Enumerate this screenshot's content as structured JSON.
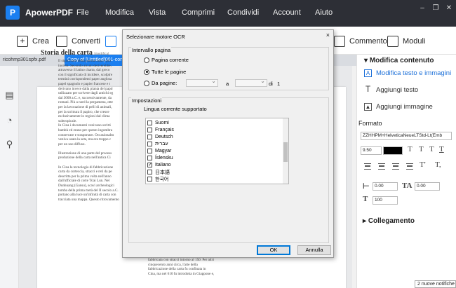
{
  "app": {
    "name": "ApowerPDF",
    "logo_letter": "P"
  },
  "menu": [
    "File",
    "Modifica",
    "Vista",
    "Comprimi",
    "Condividi",
    "Account",
    "Aiuto"
  ],
  "toolbar": {
    "crea": "Crea",
    "converti": "Converti",
    "commento": "Commento",
    "moduli": "Moduli"
  },
  "tabs": [
    {
      "label": "ricohmp301spfx.pdf",
      "active": false
    },
    {
      "label": "Copy of [Untitled]001-conve...",
      "active": true
    }
  ],
  "document": {
    "title": "Storia della carta",
    "title_note": "[modifica]",
    "col1": [
      "Il significato della parola carta è piu",
      "incerto. Secondo alcuni deriverebbe,",
      "attraverso il latino charta, dal greco",
      "con il significato di incidere, scolpire",
      "termini corrispondenti paper anglosa",
      "papel spagnolo e papier francese e t",
      "derivano invece dalla pianta del papir",
      "utilizzato per scrivere dagli antichi eg",
      "dal 3000 a.C. e, successivamente, da",
      "romani. Più a nord la pergamena, otte",
      "per la lavorazione di pelli di animali,",
      "per la scrittura il papiro, che cresce",
      "esclusivamente in regioni dal clima",
      "subtropicale.",
      "In Cina i documenti venivano scritti",
      "bambù ed erano per questo ingombra",
      "conservare e trasportare. Occasionalm",
      "veniva usata la seta, ma era troppo c",
      "per un uso diffuso.",
      "",
      "Illustrazione di una parte del process",
      "produzione della carta nell'antica Ci",
      "",
      "In Cina la tecnologia di fabbricazione",
      "carta da corteccia, stracci e reti da pe",
      "descritta per la prima volta nell'anno",
      "dall'ufficiale di corte Ts'ai Lun. Nel",
      "Dunhuang (Gansu), scavi archeologici",
      "tomba della prima metà del II secolo a.C.",
      "portano alla luce un'infinità di carta con",
      "tracciata una mappa. Questo ritrovamento"
    ],
    "col2": [
      "fabbricata con stracci intorno al 150. Per altri",
      "cinquecento anni circa, l'arte della",
      "fabbricazione della carta fu confinata in",
      "Cina, ma nel 610 fu introdotta in Giappone e,"
    ]
  },
  "right_panel": {
    "modifica_contenuto": "Modifica contenuto",
    "items": [
      "Modifica testo e immagini",
      "Aggiungi testo",
      "Aggiungi immagine"
    ],
    "formato": "Formato",
    "font": "ZZHHPM+HelveticaNeueLTStd-Lt(Emb",
    "font_size": "9.50",
    "text_color": "#000000",
    "spacing1": "0.00",
    "spacing2": "0.00",
    "scale": "100",
    "collegamento": "Collegamento"
  },
  "notification": "2 nuove notifiche",
  "dialog": {
    "title": "Selezionare motore OCR",
    "close": "×",
    "intervallo_pagina": "Intervallo pagina",
    "radio_pagina_corrente": "Pagina corrente",
    "radio_tutte": "Tutte le pagine",
    "radio_da_pagine": "Da pagine:",
    "selected_range": "tutte",
    "a_label": "a",
    "di_label": "di",
    "total_pages": "1",
    "impostazioni": "Impostazioni",
    "lingua_label": "Lingua corrente supportato",
    "languages": [
      {
        "name": "Suomi",
        "checked": false
      },
      {
        "name": "Français",
        "checked": false
      },
      {
        "name": "Deutsch",
        "checked": false
      },
      {
        "name": "עברית",
        "checked": false
      },
      {
        "name": "Magyar",
        "checked": false
      },
      {
        "name": "Íslensku",
        "checked": false
      },
      {
        "name": "Italiano",
        "checked": true
      },
      {
        "name": "日本語",
        "checked": false
      },
      {
        "name": "한국어",
        "checked": false
      }
    ],
    "ok": "OK",
    "annulla": "Annulla"
  }
}
